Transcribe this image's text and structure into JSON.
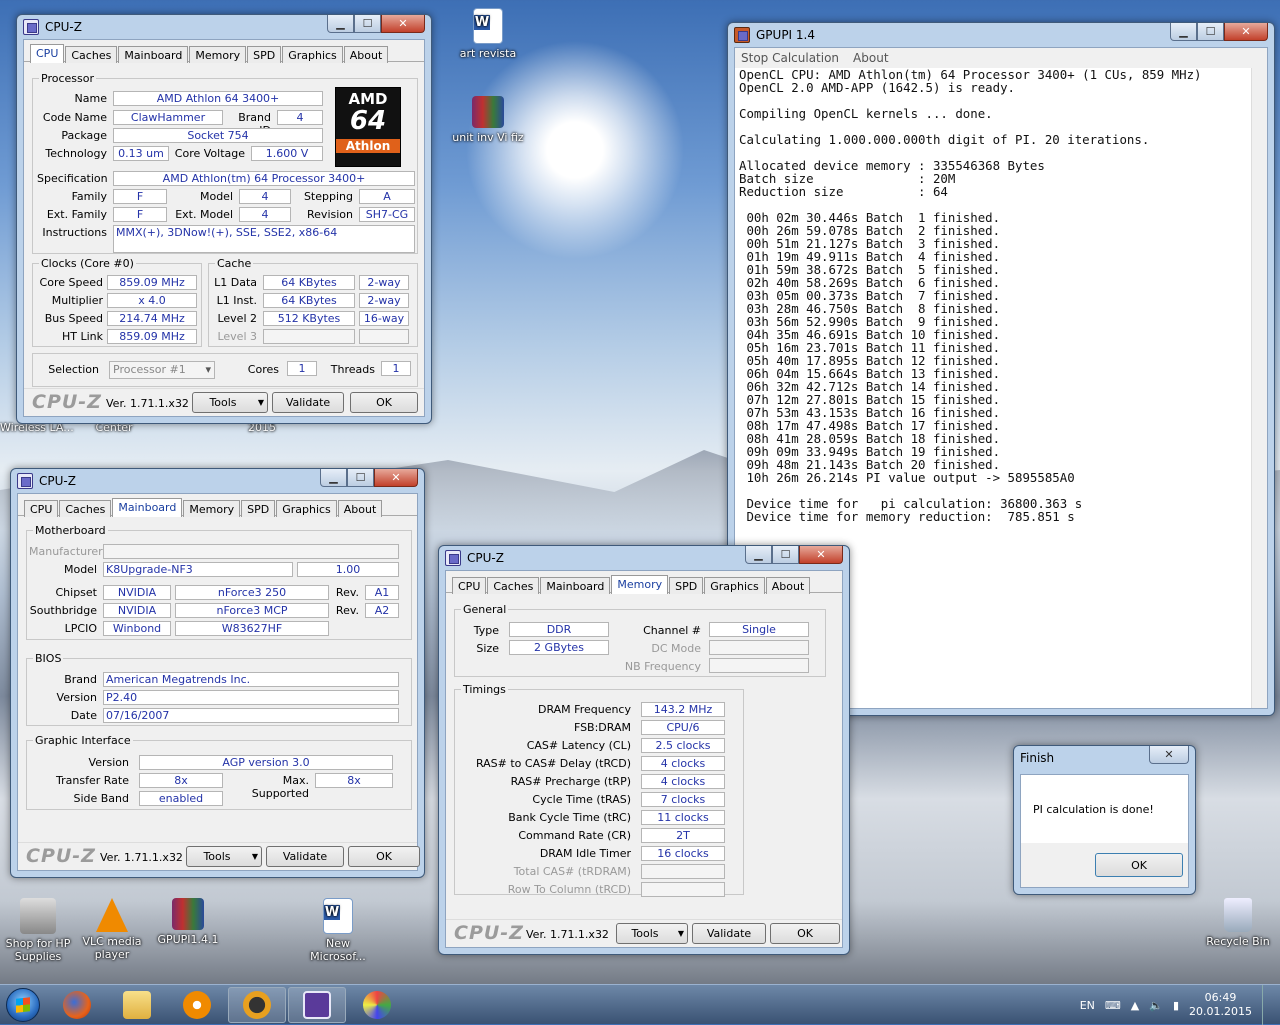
{
  "desktop": {
    "icons": [
      {
        "label": "art revista"
      },
      {
        "label": "unit inv Vi fiz"
      },
      {
        "label": "Shop for HP Supplies"
      },
      {
        "label": "VLC media player"
      },
      {
        "label": "GPUPI1.4.1"
      },
      {
        "label": "New Microsof..."
      },
      {
        "label": "Recycle Bin"
      },
      {
        "label": "Wireless LA..."
      },
      {
        "label": "Center"
      },
      {
        "label": "2015"
      }
    ]
  },
  "cpuz1": {
    "title": "CPU-Z",
    "tabs": [
      "CPU",
      "Caches",
      "Mainboard",
      "Memory",
      "SPD",
      "Graphics",
      "About"
    ],
    "active_tab": "CPU",
    "processor_legend": "Processor",
    "labels": {
      "name": "Name",
      "code_name": "Code Name",
      "brand_id": "Brand ID",
      "package": "Package",
      "technology": "Technology",
      "core_voltage": "Core Voltage",
      "specification": "Specification",
      "family": "Family",
      "model": "Model",
      "stepping": "Stepping",
      "ext_family": "Ext. Family",
      "ext_model": "Ext. Model",
      "revision": "Revision",
      "instructions": "Instructions"
    },
    "values": {
      "name": "AMD Athlon 64 3400+",
      "code_name": "ClawHammer",
      "brand_id": "4",
      "package": "Socket 754",
      "technology": "0.13 um",
      "core_voltage": "1.600 V",
      "specification": "AMD Athlon(tm) 64 Processor 3400+",
      "family": "F",
      "model": "4",
      "stepping": "A",
      "ext_family": "F",
      "ext_model": "4",
      "revision": "SH7-CG",
      "instructions": "MMX(+), 3DNow!(+), SSE, SSE2, x86-64"
    },
    "logo": {
      "top": "AMD",
      "mid": "64",
      "bottom": "Athlon"
    },
    "clocks_legend": "Clocks (Core #0)",
    "clock_labels": [
      "Core Speed",
      "Multiplier",
      "Bus Speed",
      "HT Link"
    ],
    "clock_values": [
      "859.09 MHz",
      "x 4.0",
      "214.74 MHz",
      "859.09 MHz"
    ],
    "cache_legend": "Cache",
    "cache_labels": [
      "L1 Data",
      "L1 Inst.",
      "Level 2",
      "Level 3"
    ],
    "cache_sizes": [
      "64 KBytes",
      "64 KBytes",
      "512 KBytes",
      ""
    ],
    "cache_ways": [
      "2-way",
      "2-way",
      "16-way",
      ""
    ],
    "selection_label": "Selection",
    "selection_value": "Processor #1",
    "cores_label": "Cores",
    "cores_value": "1",
    "threads_label": "Threads",
    "threads_value": "1",
    "footer": {
      "logo": "CPU-Z",
      "version": "Ver. 1.71.1.x32",
      "tools": "Tools",
      "validate": "Validate",
      "ok": "OK"
    }
  },
  "cpuz2": {
    "title": "CPU-Z",
    "tabs": [
      "CPU",
      "Caches",
      "Mainboard",
      "Memory",
      "SPD",
      "Graphics",
      "About"
    ],
    "active_tab": "Mainboard",
    "motherboard_legend": "Motherboard",
    "labels": {
      "manufacturer": "Manufacturer",
      "model": "Model",
      "chipset": "Chipset",
      "rev": "Rev.",
      "southbridge": "Southbridge",
      "lpcio": "LPCIO"
    },
    "values": {
      "manufacturer": "",
      "model": "K8Upgrade-NF3",
      "model_rev": "1.00",
      "chipset_vendor": "NVIDIA",
      "chipset_name": "nForce3 250",
      "chipset_rev": "A1",
      "sb_vendor": "NVIDIA",
      "sb_name": "nForce3 MCP",
      "sb_rev": "A2",
      "lpcio_vendor": "Winbond",
      "lpcio_name": "W83627HF"
    },
    "bios_legend": "BIOS",
    "bios_labels": {
      "brand": "Brand",
      "version": "Version",
      "date": "Date"
    },
    "bios_values": {
      "brand": "American Megatrends Inc.",
      "version": "P2.40",
      "date": "07/16/2007"
    },
    "graphic_legend": "Graphic Interface",
    "gi_labels": {
      "version": "Version",
      "transfer": "Transfer Rate",
      "max": "Max. Supported",
      "side": "Side Band"
    },
    "gi_values": {
      "version": "AGP version 3.0",
      "transfer": "8x",
      "max": "8x",
      "side": "enabled"
    },
    "footer": {
      "logo": "CPU-Z",
      "version": "Ver. 1.71.1.x32",
      "tools": "Tools",
      "validate": "Validate",
      "ok": "OK"
    }
  },
  "cpuz3": {
    "title": "CPU-Z",
    "tabs": [
      "CPU",
      "Caches",
      "Mainboard",
      "Memory",
      "SPD",
      "Graphics",
      "About"
    ],
    "active_tab": "Memory",
    "general_legend": "General",
    "general_labels": {
      "type": "Type",
      "size": "Size",
      "channel": "Channel #",
      "dc": "DC Mode",
      "nb": "NB Frequency"
    },
    "general_values": {
      "type": "DDR",
      "size": "2 GBytes",
      "channel": "Single",
      "dc": "",
      "nb": ""
    },
    "timings_legend": "Timings",
    "timing_labels": [
      "DRAM Frequency",
      "FSB:DRAM",
      "CAS# Latency (CL)",
      "RAS# to CAS# Delay (tRCD)",
      "RAS# Precharge (tRP)",
      "Cycle Time (tRAS)",
      "Bank Cycle Time (tRC)",
      "Command Rate (CR)",
      "DRAM Idle Timer",
      "Total CAS# (tRDRAM)",
      "Row To Column (tRCD)"
    ],
    "timing_values": [
      "143.2 MHz",
      "CPU/6",
      "2.5 clocks",
      "4 clocks",
      "4 clocks",
      "7 clocks",
      "11 clocks",
      "2T",
      "16 clocks",
      "",
      ""
    ],
    "footer": {
      "logo": "CPU-Z",
      "version": "Ver. 1.71.1.x32",
      "tools": "Tools",
      "validate": "Validate",
      "ok": "OK"
    }
  },
  "gpupi": {
    "title": "GPUPI 1.4",
    "menu": [
      "Stop Calculation",
      "About"
    ],
    "lines": [
      "OpenCL CPU: AMD Athlon(tm) 64 Processor 3400+ (1 CUs, 859 MHz)",
      "OpenCL 2.0 AMD-APP (1642.5) is ready.",
      "",
      "Compiling OpenCL kernels ... done.",
      "",
      "Calculating 1.000.000.000th digit of PI. 20 iterations.",
      "",
      "Allocated device memory : 335546368 Bytes",
      "Batch size              : 20M",
      "Reduction size          : 64",
      "",
      " 00h 02m 30.446s Batch  1 finished.",
      " 00h 26m 59.078s Batch  2 finished.",
      " 00h 51m 21.127s Batch  3 finished.",
      " 01h 19m 49.911s Batch  4 finished.",
      " 01h 59m 38.672s Batch  5 finished.",
      " 02h 40m 58.269s Batch  6 finished.",
      " 03h 05m 00.373s Batch  7 finished.",
      " 03h 28m 46.750s Batch  8 finished.",
      " 03h 56m 52.990s Batch  9 finished.",
      " 04h 35m 46.691s Batch 10 finished.",
      " 05h 16m 23.701s Batch 11 finished.",
      " 05h 40m 17.895s Batch 12 finished.",
      " 06h 04m 15.664s Batch 13 finished.",
      " 06h 32m 42.712s Batch 14 finished.",
      " 07h 12m 27.801s Batch 15 finished.",
      " 07h 53m 43.153s Batch 16 finished.",
      " 08h 17m 47.498s Batch 17 finished.",
      " 08h 41m 28.059s Batch 18 finished.",
      " 09h 09m 33.949s Batch 19 finished.",
      " 09h 48m 21.143s Batch 20 finished.",
      " 10h 26m 26.214s PI value output -> 5895585A0",
      "",
      " Device time for   pi calculation: 36800.363 s",
      " Device time for memory reduction:  785.851 s"
    ]
  },
  "finish": {
    "title": "Finish",
    "message": "PI calculation is done!",
    "ok": "OK"
  },
  "taskbar": {
    "lang": "EN",
    "time": "06:49",
    "date": "20.01.2015"
  }
}
